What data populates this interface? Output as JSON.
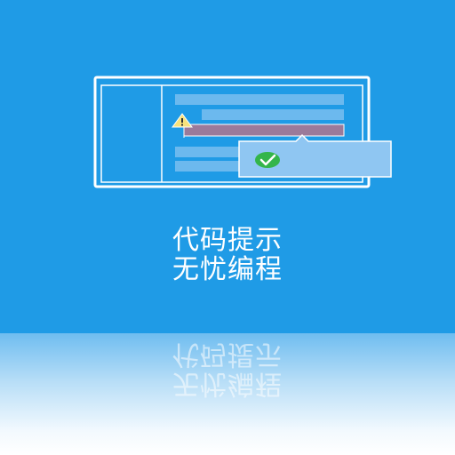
{
  "tile": {
    "background": "#1f9be6",
    "caption_line1": "代码提示",
    "caption_line2": "无忧编程"
  },
  "illustration": {
    "icons": [
      "warning-icon",
      "checkmark-icon"
    ],
    "colors": {
      "frame": "#ffffff",
      "code_line": "#6cb9ee",
      "error_highlight": "#9b7a9a",
      "warning": "#f7e27c",
      "popup": "#8fc6f2",
      "check": "#34b54a"
    }
  }
}
